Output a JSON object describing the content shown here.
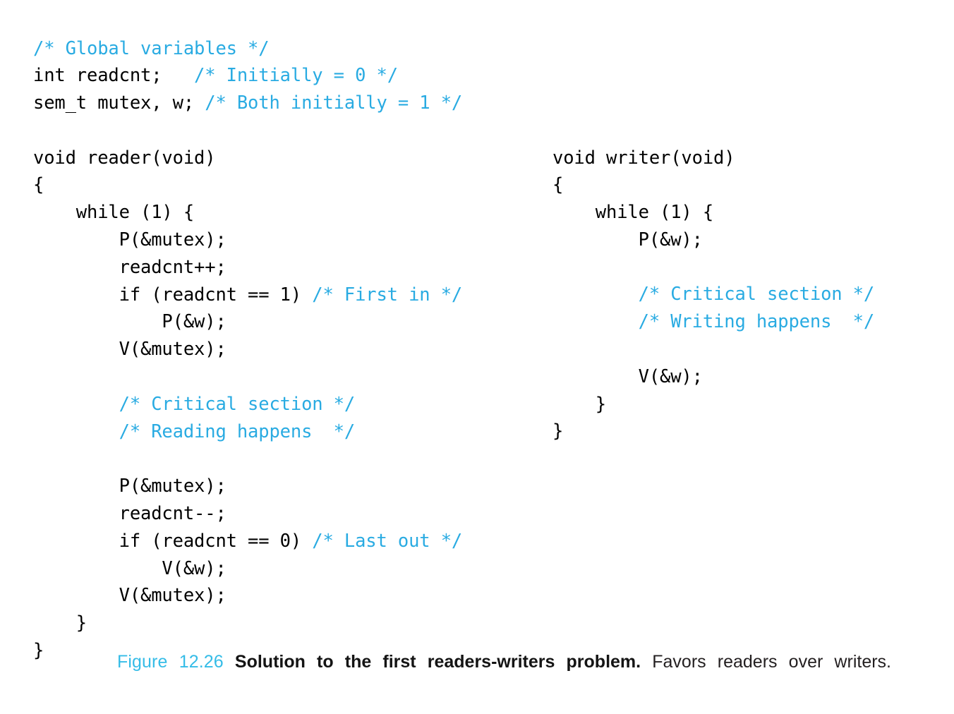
{
  "figure": {
    "caption": {
      "number": "Figure 12.26",
      "bold_title": "Solution to the first readers-writers problem.",
      "rest": "Favors readers over writers."
    },
    "code_left": [
      [
        {
          "t": "/* Global variables */",
          "c": "comment"
        }
      ],
      [
        {
          "t": "int readcnt;   ",
          "c": "code"
        },
        {
          "t": "/* Initially = 0 */",
          "c": "comment"
        }
      ],
      [
        {
          "t": "sem_t mutex, w; ",
          "c": "code"
        },
        {
          "t": "/* Both initially = 1 */",
          "c": "comment"
        }
      ],
      [],
      [
        {
          "t": "void reader(void)",
          "c": "code"
        }
      ],
      [
        {
          "t": "{",
          "c": "code"
        }
      ],
      [
        {
          "t": "    while (1) {",
          "c": "code"
        }
      ],
      [
        {
          "t": "        P(&mutex);",
          "c": "code"
        }
      ],
      [
        {
          "t": "        readcnt++;",
          "c": "code"
        }
      ],
      [
        {
          "t": "        if (readcnt == 1) ",
          "c": "code"
        },
        {
          "t": "/* First in */",
          "c": "comment"
        }
      ],
      [
        {
          "t": "            P(&w);",
          "c": "code"
        }
      ],
      [
        {
          "t": "        V(&mutex);",
          "c": "code"
        }
      ],
      [],
      [
        {
          "t": "        ",
          "c": "code"
        },
        {
          "t": "/* Critical section */",
          "c": "comment"
        }
      ],
      [
        {
          "t": "        ",
          "c": "code"
        },
        {
          "t": "/* Reading happens  */",
          "c": "comment"
        }
      ],
      [],
      [
        {
          "t": "        P(&mutex);",
          "c": "code"
        }
      ],
      [
        {
          "t": "        readcnt--;",
          "c": "code"
        }
      ],
      [
        {
          "t": "        if (readcnt == 0) ",
          "c": "code"
        },
        {
          "t": "/* Last out */",
          "c": "comment"
        }
      ],
      [
        {
          "t": "            V(&w);",
          "c": "code"
        }
      ],
      [
        {
          "t": "        V(&mutex);",
          "c": "code"
        }
      ],
      [
        {
          "t": "    }",
          "c": "code"
        }
      ],
      [
        {
          "t": "}",
          "c": "code"
        }
      ]
    ],
    "code_right": [
      [
        {
          "t": "void writer(void)",
          "c": "code"
        }
      ],
      [
        {
          "t": "{",
          "c": "code"
        }
      ],
      [
        {
          "t": "    while (1) {",
          "c": "code"
        }
      ],
      [
        {
          "t": "        P(&w);",
          "c": "code"
        }
      ],
      [],
      [
        {
          "t": "        ",
          "c": "code"
        },
        {
          "t": "/* Critical section */",
          "c": "comment"
        }
      ],
      [
        {
          "t": "        ",
          "c": "code"
        },
        {
          "t": "/* Writing happens  */",
          "c": "comment"
        }
      ],
      [],
      [
        {
          "t": "        V(&w);",
          "c": "code"
        }
      ],
      [
        {
          "t": "    }",
          "c": "code"
        }
      ],
      [
        {
          "t": "}",
          "c": "code"
        }
      ]
    ],
    "colors": {
      "comment": "#29abe2",
      "code": "#000000",
      "caption_number": "#35bce7",
      "background": "#ffffff"
    }
  }
}
